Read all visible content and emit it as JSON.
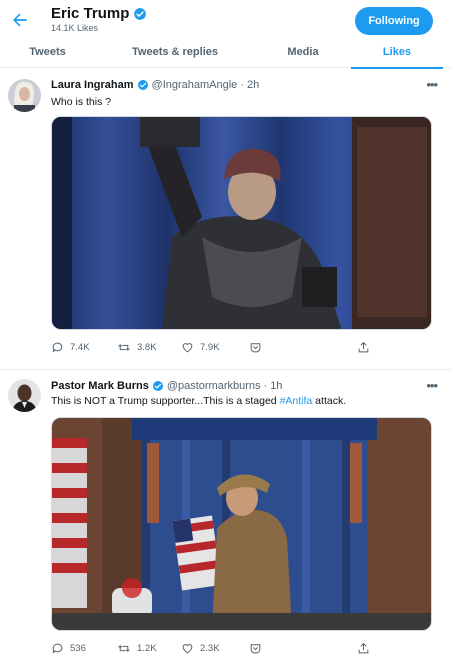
{
  "header": {
    "name": "Eric Trump",
    "likes_count": "14.1K Likes",
    "follow_label": "Following"
  },
  "tabs": [
    {
      "label": "Tweets"
    },
    {
      "label": "Tweets & replies"
    },
    {
      "label": "Media"
    },
    {
      "label": "Likes",
      "active": true
    }
  ],
  "tweets": [
    {
      "name": "Laura Ingraham",
      "handle": "@IngrahamAngle",
      "dot": "·",
      "time": "2h",
      "text": "Who is this ?",
      "replies": "7.4K",
      "retweets": "3.8K",
      "likes": "7.9K"
    },
    {
      "name": "Pastor Mark Burns",
      "handle": "@pastormarkburns",
      "dot": "·",
      "time": "1h",
      "text_before": "This is NOT a Trump supporter...This is a staged ",
      "hashtag": "#Antifa",
      "text_after": " attack.",
      "replies": "536",
      "retweets": "1.2K",
      "likes": "2.3K"
    }
  ],
  "colors": {
    "accent": "#1d9bf0",
    "text_secondary": "#536471",
    "border": "#e6ecf0"
  }
}
